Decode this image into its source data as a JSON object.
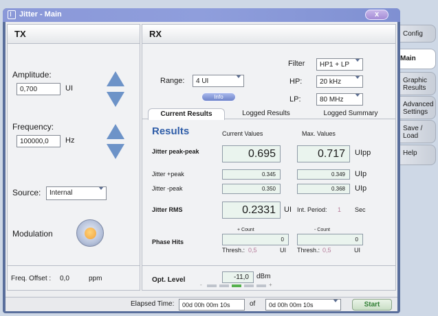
{
  "window": {
    "title": "Jitter - Main",
    "close": "x"
  },
  "side_tabs": [
    {
      "label": "Config",
      "active": false
    },
    {
      "label": "Main",
      "active": true
    },
    {
      "label": "Graphic Results",
      "active": false
    },
    {
      "label": "Advanced Settings",
      "active": false
    },
    {
      "label": "Save / Load",
      "active": false
    },
    {
      "label": "Help",
      "active": false
    }
  ],
  "tx": {
    "title": "TX",
    "amplitude_label": "Amplitude:",
    "amplitude_value": "0,700",
    "amplitude_unit": "UI",
    "frequency_label": "Frequency:",
    "frequency_value": "100000,0",
    "frequency_unit": "Hz",
    "source_label": "Source:",
    "source_value": "Internal",
    "modulation_label": "Modulation",
    "freq_offset_label": "Freq. Offset :",
    "freq_offset_value": "0,0",
    "freq_offset_unit": "ppm"
  },
  "rx": {
    "title": "RX",
    "range_label": "Range:",
    "range_value": "4 UI",
    "info_label": "Info",
    "filter_label": "Filter",
    "filter_value": "HP1 + LP",
    "hp_label": "HP:",
    "hp_value": "20 kHz",
    "lp_label": "LP:",
    "lp_value": "80 MHz",
    "tabs": [
      "Current Results",
      "Logged Results",
      "Logged Summary"
    ],
    "results_title": "Results",
    "col_current": "Current Values",
    "col_max": "Max. Values",
    "rows": [
      {
        "label": "Jitter peak-peak",
        "current": "0.695",
        "max": "0.717",
        "unit": "UIpp"
      },
      {
        "label": "Jitter +peak",
        "current": "0.345",
        "max": "0.349",
        "unit": "UIp"
      },
      {
        "label": "Jitter -peak",
        "current": "0.350",
        "max": "0.368",
        "unit": "UIp"
      }
    ],
    "rms_label": "Jitter RMS",
    "rms_value": "0.2331",
    "rms_unit": "UI",
    "int_period_label": "Int. Period:",
    "int_period_value": "1",
    "int_period_unit": "Sec",
    "phase_hits_label": "Phase Hits",
    "plus_count_label": "+ Count",
    "plus_count_value": "0",
    "minus_count_label": "- Count",
    "minus_count_value": "0",
    "thresh_label": "Thresh.:",
    "thresh_plus_value": "0,5",
    "thresh_minus_value": "0,5",
    "thresh_unit": "UI",
    "opt_level_label": "Opt. Level",
    "opt_level_value": "-11,0",
    "opt_level_unit": "dBm",
    "opt_minus": "-",
    "opt_plus": "+"
  },
  "footer": {
    "elapsed_label": "Elapsed Time:",
    "elapsed_value": "00d 00h 00m 10s",
    "of_label": "of",
    "total_value": "0d 00h 00m 10s",
    "start_label": "Start"
  },
  "colors": {
    "accent": "#2f5da8",
    "value_bg": "#eaf4ee",
    "thresh_text": "#b57a98",
    "start_text": "#2e7d32"
  }
}
